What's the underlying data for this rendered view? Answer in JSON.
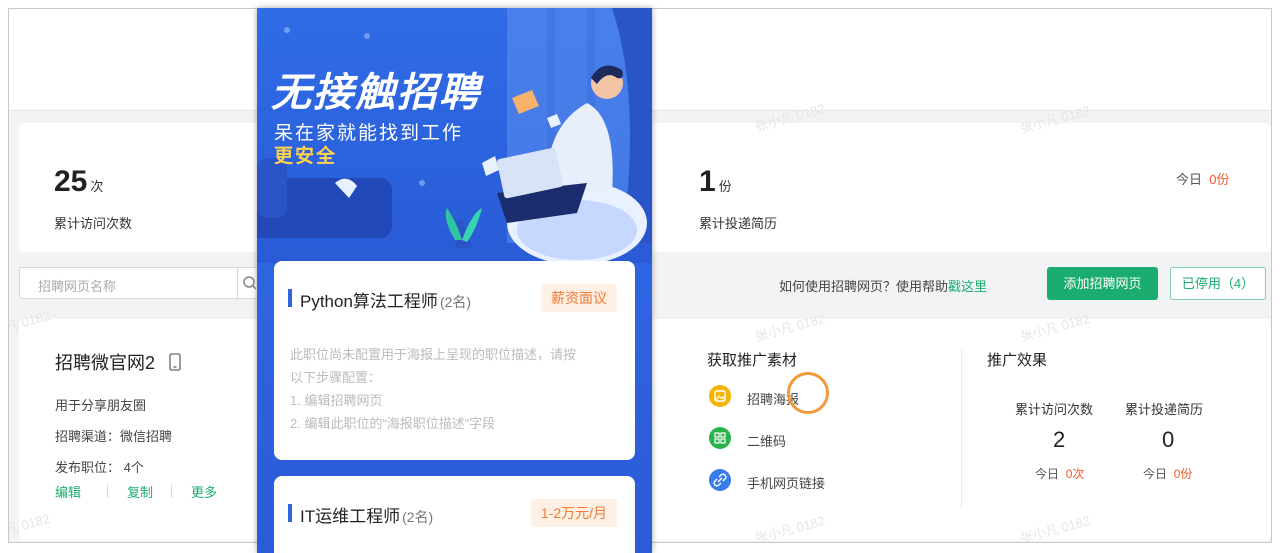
{
  "stats": {
    "visits": {
      "value": "25",
      "unit": "次",
      "label": "累计访问次数"
    },
    "resumes": {
      "value": "1",
      "unit": "份",
      "label": "累计投递简历"
    },
    "today_prefix": "今日",
    "today_resumes": "0份"
  },
  "toolbar": {
    "search_placeholder": "招聘网页名称",
    "help_text": "如何使用招聘网页？使用帮助",
    "help_link": "戳这里",
    "add_button": "添加招聘网页",
    "disabled_button": "已停用（4）"
  },
  "site": {
    "name": "招聘微官网2",
    "purpose": "用于分享朋友圈",
    "channel": "招聘渠道：微信招聘",
    "positions": "发布职位：  4个",
    "actions": {
      "edit": "编辑",
      "copy": "复制",
      "more": "更多"
    }
  },
  "materials": {
    "title": "获取推广素材",
    "items": [
      {
        "label": "招聘海报",
        "icon": "image-icon",
        "color": "#f6b300"
      },
      {
        "label": "二维码",
        "icon": "qr-code-icon",
        "color": "#2bb24c"
      },
      {
        "label": "手机网页链接",
        "icon": "link-icon",
        "color": "#3a7bea"
      }
    ]
  },
  "effects": {
    "title": "推广效果",
    "visits_label": "累计访问次数",
    "resumes_label": "累计投递简历",
    "visits_value": "2",
    "resumes_value": "0",
    "today_prefix": "今日",
    "today_visits": "0次",
    "today_resumes": "0份"
  },
  "poster": {
    "title": "无接触招聘",
    "subtitle": "呆在家就能找到工作",
    "subtitle2": "更安全",
    "jobs": [
      {
        "title": "Python算法工程师",
        "count": "(2名)",
        "salary": "薪资面议",
        "desc": [
          "此职位尚未配置用于海报上呈现的职位描述，请按",
          "以下步骤配置：",
          "1. 编辑招聘网页",
          "2. 编辑此职位的“海报职位描述”字段"
        ]
      },
      {
        "title": "IT运维工程师",
        "count": "(2名)",
        "salary": "1-2万元/月"
      }
    ]
  },
  "watermark": "张小凡 0182",
  "colors": {
    "accent": "#1aad6f",
    "warning": "#f05a2b",
    "poster_blue": "#2f63df"
  }
}
